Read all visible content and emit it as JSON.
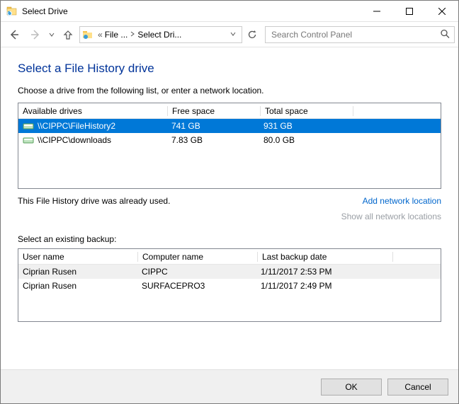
{
  "window": {
    "title": "Select Drive"
  },
  "breadcrumb": {
    "seg1": "File ...",
    "seg2": "Select Dri..."
  },
  "search": {
    "placeholder": "Search Control Panel"
  },
  "page": {
    "heading": "Select a File History drive",
    "instruction": "Choose a drive from the following list, or enter a network location.",
    "status": "This File History drive was already used.",
    "select_backup_label": "Select an existing backup:"
  },
  "drives": {
    "headers": {
      "name": "Available drives",
      "free": "Free space",
      "total": "Total space"
    },
    "rows": [
      {
        "name": "\\\\CIPPC\\FileHistory2",
        "free": "741 GB",
        "total": "931 GB",
        "selected": true
      },
      {
        "name": "\\\\CIPPC\\downloads",
        "free": "7.83 GB",
        "total": "80.0 GB",
        "selected": false
      }
    ]
  },
  "links": {
    "add_network": "Add network location",
    "show_all": "Show all network locations"
  },
  "backups": {
    "headers": {
      "user": "User name",
      "computer": "Computer name",
      "date": "Last backup date"
    },
    "rows": [
      {
        "user": "Ciprian Rusen",
        "computer": "CIPPC",
        "date": "1/11/2017 2:53 PM"
      },
      {
        "user": "Ciprian Rusen",
        "computer": "SURFACEPRO3",
        "date": "1/11/2017 2:49 PM"
      }
    ]
  },
  "buttons": {
    "ok": "OK",
    "cancel": "Cancel"
  }
}
